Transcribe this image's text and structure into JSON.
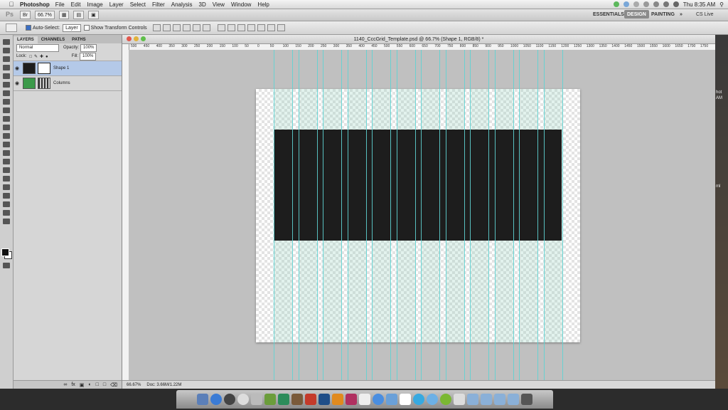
{
  "menubar": {
    "app_name": "Photoshop",
    "menus": [
      "File",
      "Edit",
      "Image",
      "Layer",
      "Select",
      "Filter",
      "Analysis",
      "3D",
      "View",
      "Window",
      "Help"
    ],
    "clock": "Thu 8:35 AM"
  },
  "appbar": {
    "zoom": "66.7%",
    "workspaces": [
      "ESSENTIALS",
      "DESIGN",
      "PAINTING"
    ],
    "active_workspace": "DESIGN",
    "cs_live": "CS Live"
  },
  "options": {
    "auto_select_label": "Auto-Select:",
    "auto_select_value": "Layer",
    "transform_label": "Show Transform Controls"
  },
  "layers_panel": {
    "tabs": [
      "LAYERS",
      "CHANNELS",
      "PATHS"
    ],
    "blend_mode": "Normal",
    "opacity_label": "Opacity:",
    "opacity_value": "100%",
    "lock_label": "Lock:",
    "fill_label": "Fill:",
    "fill_value": "100%",
    "layers": [
      {
        "name": "Shape 1"
      },
      {
        "name": "Columns"
      }
    ]
  },
  "document": {
    "title": "1140_CccGrid_Template.psd @ 66.7% (Shape 1, RGB/8) *",
    "ruler_labels": [
      "500",
      "450",
      "400",
      "350",
      "300",
      "250",
      "200",
      "150",
      "100",
      "50",
      "0",
      "50",
      "100",
      "150",
      "200",
      "250",
      "300",
      "350",
      "400",
      "450",
      "500",
      "550",
      "600",
      "650",
      "700",
      "750",
      "800",
      "850",
      "900",
      "950",
      "1000",
      "1050",
      "1100",
      "1150",
      "1200",
      "1250",
      "1300",
      "1350",
      "1400",
      "1450",
      "1500",
      "1550",
      "1600",
      "1650",
      "1700",
      "1750"
    ],
    "status_zoom": "66.67%",
    "status_doc": "Doc: 3.66M/1.22M"
  },
  "desktop_strip": {
    "labels": [
      "hot",
      "AM",
      "ml"
    ]
  }
}
